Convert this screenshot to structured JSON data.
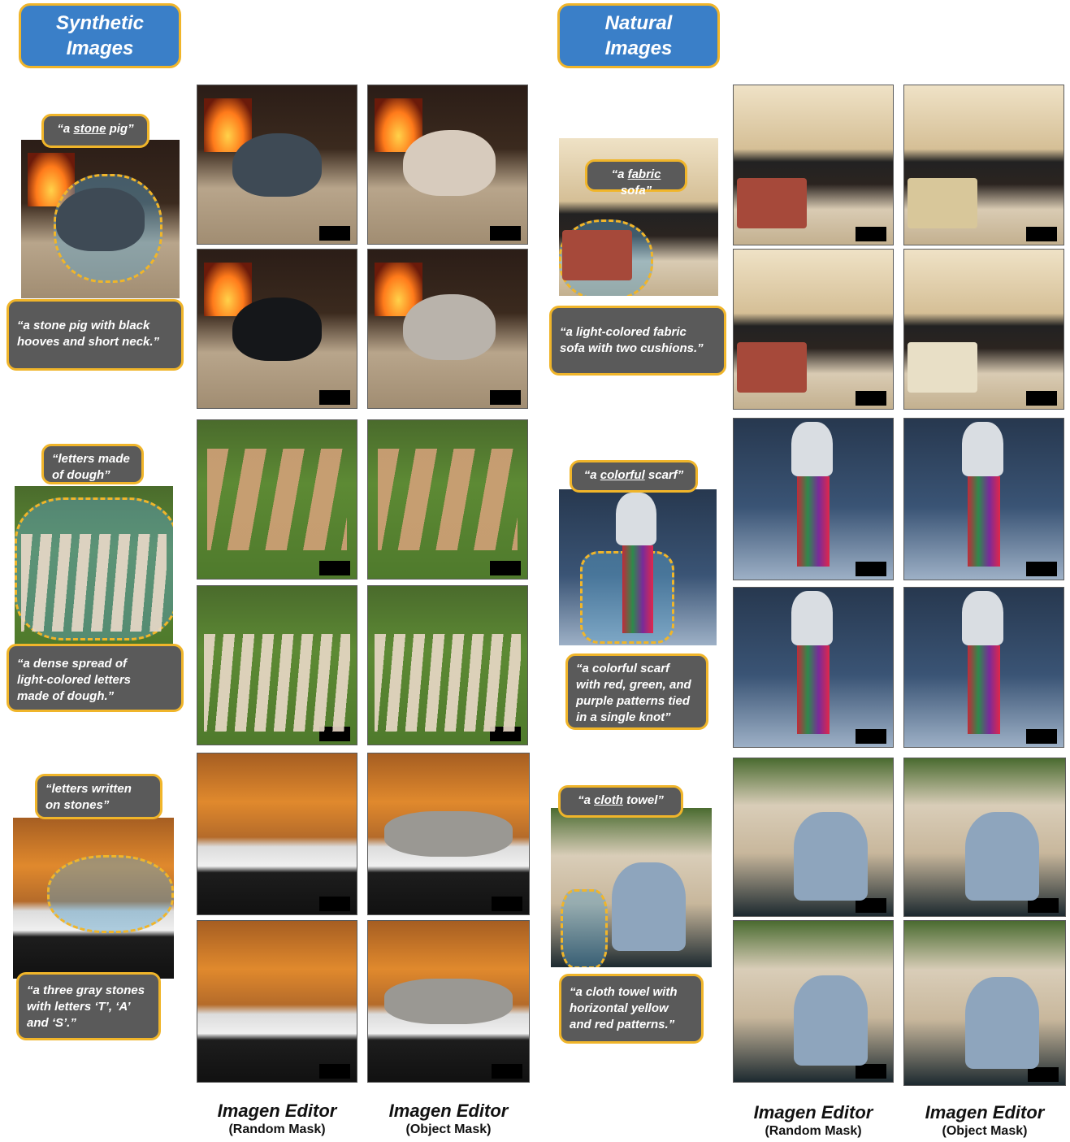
{
  "headers": {
    "synthetic": [
      "Synthetic",
      "Images"
    ],
    "natural": [
      "Natural",
      "Images"
    ]
  },
  "column_labels": {
    "title": "Imagen Editor",
    "random": "(Random Mask)",
    "object": "(Object Mask)"
  },
  "rows": [
    {
      "short": {
        "pre": "“a ",
        "u": "stone",
        "post": " pig”"
      },
      "long_lines": [
        "“a stone pig with black",
        "hooves and short neck.”"
      ]
    },
    {
      "short_lines": [
        "“letters made",
        "of dough”"
      ],
      "long_lines": [
        "“a dense spread of",
        "light-colored letters",
        "made of dough.”"
      ]
    },
    {
      "short_lines": [
        "“letters written",
        "on stones”"
      ],
      "long_lines": [
        "“a three gray stones",
        "with letters ‘T’, ‘A’",
        "and ‘S’.”"
      ]
    },
    {
      "short": {
        "pre": "“a ",
        "u": "fabric",
        "post": " sofa”"
      },
      "long_lines": [
        "“a light-colored fabric",
        "sofa with two cushions.”"
      ]
    },
    {
      "short": {
        "pre": "“a ",
        "u": "colorful",
        "post": " scarf”"
      },
      "long_lines": [
        "“a colorful scarf",
        "with red, green, and",
        "purple patterns tied",
        "in a single knot”"
      ]
    },
    {
      "short": {
        "pre": "“a ",
        "u": "cloth",
        "post": " towel”"
      },
      "long_lines": [
        "“a cloth towel with",
        "horizontal yellow",
        "and red patterns.”"
      ]
    }
  ],
  "colors": {
    "accent": "#f0b52a",
    "header_bg": "#3a7fc8",
    "bubble_bg": "#5a5a5a"
  }
}
